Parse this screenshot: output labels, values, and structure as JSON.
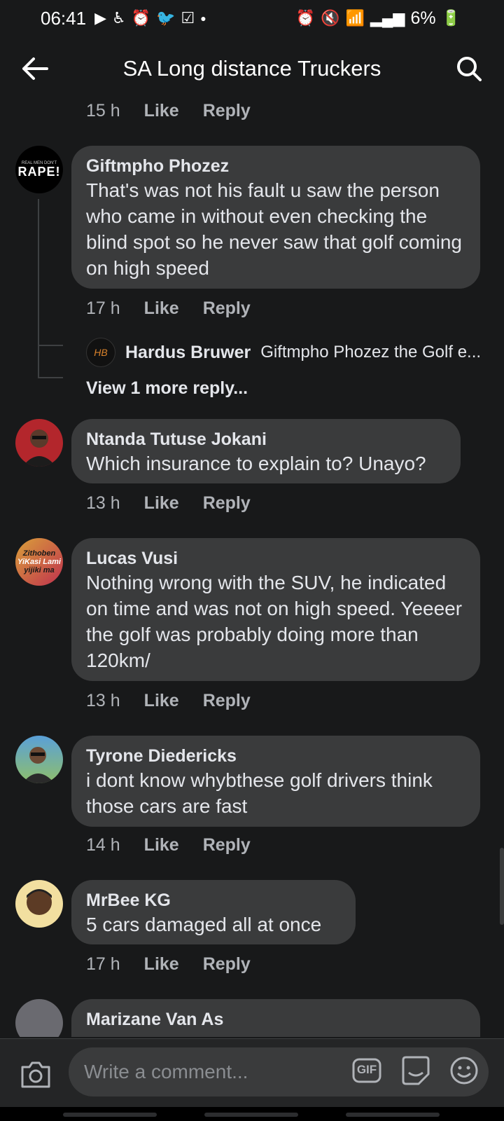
{
  "status": {
    "time": "06:41",
    "battery": "6%"
  },
  "header": {
    "title": "SA Long distance Truckers"
  },
  "labels": {
    "like": "Like",
    "reply": "Reply"
  },
  "top_actions": {
    "time": "15 h"
  },
  "comments": [
    {
      "author": "Giftmpho Phozez",
      "text": "That's was not his fault u saw the person who came in without even checking the blind spot so he never saw that golf coming on high speed",
      "time": "17 h",
      "avatar_text": "REAL MEN DON'T RAPE!"
    },
    {
      "author": "Ntanda Tutuse Jokani",
      "text": "Which insurance to explain to? Unayo?",
      "time": "13 h"
    },
    {
      "author": "Lucas Vusi",
      "text": "Nothing wrong with the SUV, he indicated on time and was not on high speed. Yeeeer the golf was probably doing more than 120km/",
      "time": "13 h",
      "avatar_text": "Zithoben YiKasi Lami yijiki ma"
    },
    {
      "author": "Tyrone Diedericks",
      "text": "i dont know whybthese golf drivers think those cars are fast",
      "time": "14 h"
    },
    {
      "author": "MrBee KG",
      "text": "5 cars damaged all at once",
      "time": "17 h"
    },
    {
      "author": "Marizane Van As"
    }
  ],
  "reply_preview": {
    "author": "Hardus Bruwer",
    "text": "Giftmpho Phozez the Golf e..."
  },
  "view_more": "View 1 more reply...",
  "composer": {
    "placeholder": "Write a comment...",
    "gif_label": "GIF"
  }
}
